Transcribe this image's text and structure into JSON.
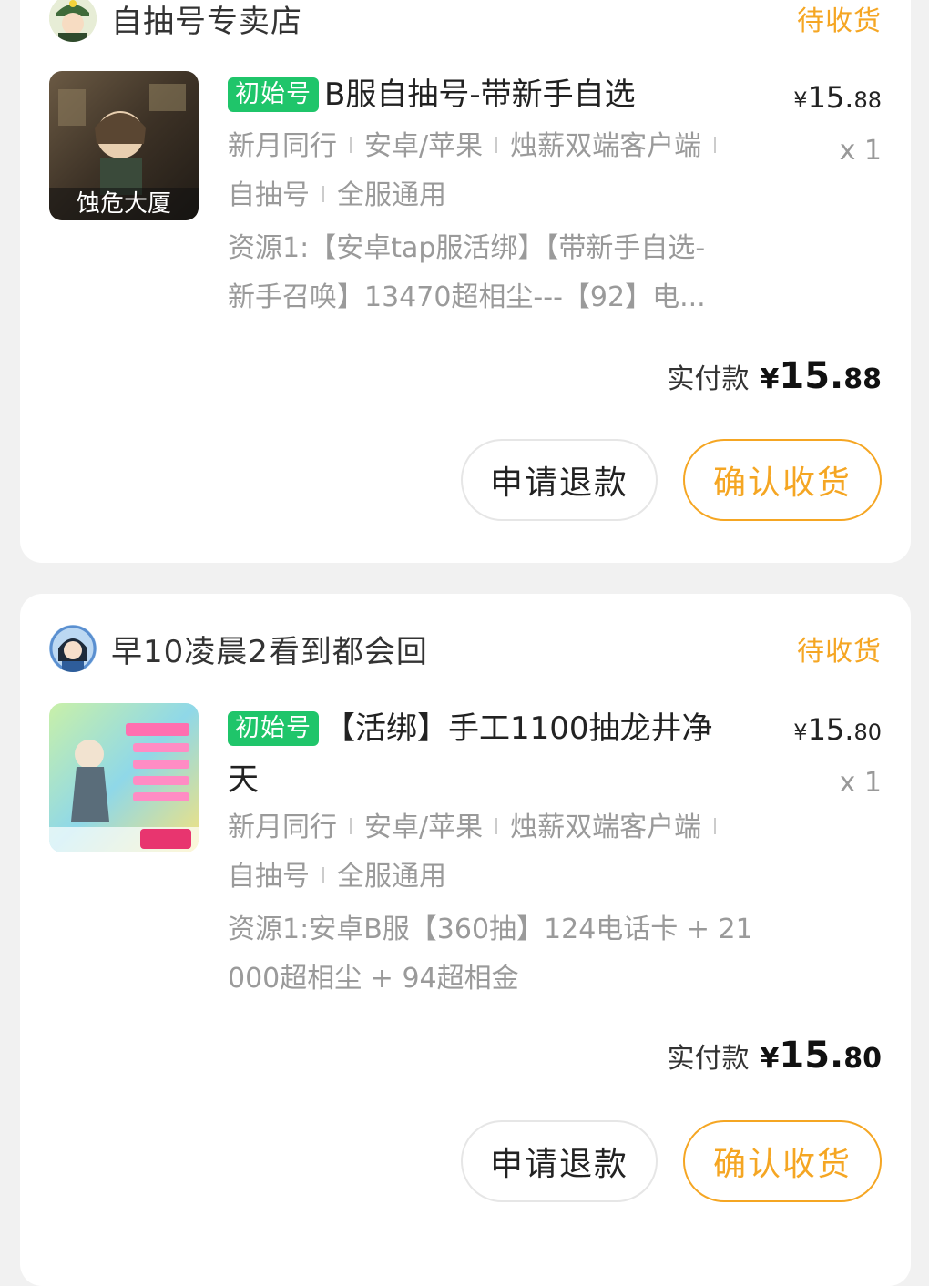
{
  "orders": [
    {
      "shop_name": "自抽号专卖店",
      "status": "待收货",
      "tag": "初始号",
      "title": "B服自抽号-带新手自选",
      "price_symbol": "¥",
      "price_int": "15.",
      "price_dec": "88",
      "qty": "x 1",
      "specs": [
        "新月同行",
        "安卓/苹果",
        "烛薪双端客户端"
      ],
      "specs2": [
        "自抽号",
        "全服通用"
      ],
      "resource_line1": "资源1:【安卓tap服活绑】【带新手自选-",
      "resource_line2": "新手召唤】13470超相尘---【92】电...",
      "paid_label": "实付款",
      "paid_symbol": "¥",
      "paid_int": "15.",
      "paid_dec": "88",
      "refund_label": "申请退款",
      "confirm_label": "确认收货",
      "thumb_text": "蚀危大厦"
    },
    {
      "shop_name": "早10凌晨2看到都会回",
      "status": "待收货",
      "tag": "初始号",
      "title_line1": "【活绑】手工1100抽龙井净",
      "title_line2": "天",
      "price_symbol": "¥",
      "price_int": "15.",
      "price_dec": "80",
      "qty": "x 1",
      "specs": [
        "新月同行",
        "安卓/苹果",
        "烛薪双端客户端"
      ],
      "specs2": [
        "自抽号",
        "全服通用"
      ],
      "resource_line1": "资源1:安卓B服【360抽】124电话卡 + 21",
      "resource_line2": "000超相尘 + 94超相金",
      "paid_label": "实付款",
      "paid_symbol": "¥",
      "paid_int": "15.",
      "paid_dec": "80",
      "refund_label": "申请退款",
      "confirm_label": "确认收货"
    }
  ],
  "colors": {
    "status": "#f5a623",
    "tag_bg": "#1fc56a",
    "page_bg": "#f1f1f1"
  }
}
